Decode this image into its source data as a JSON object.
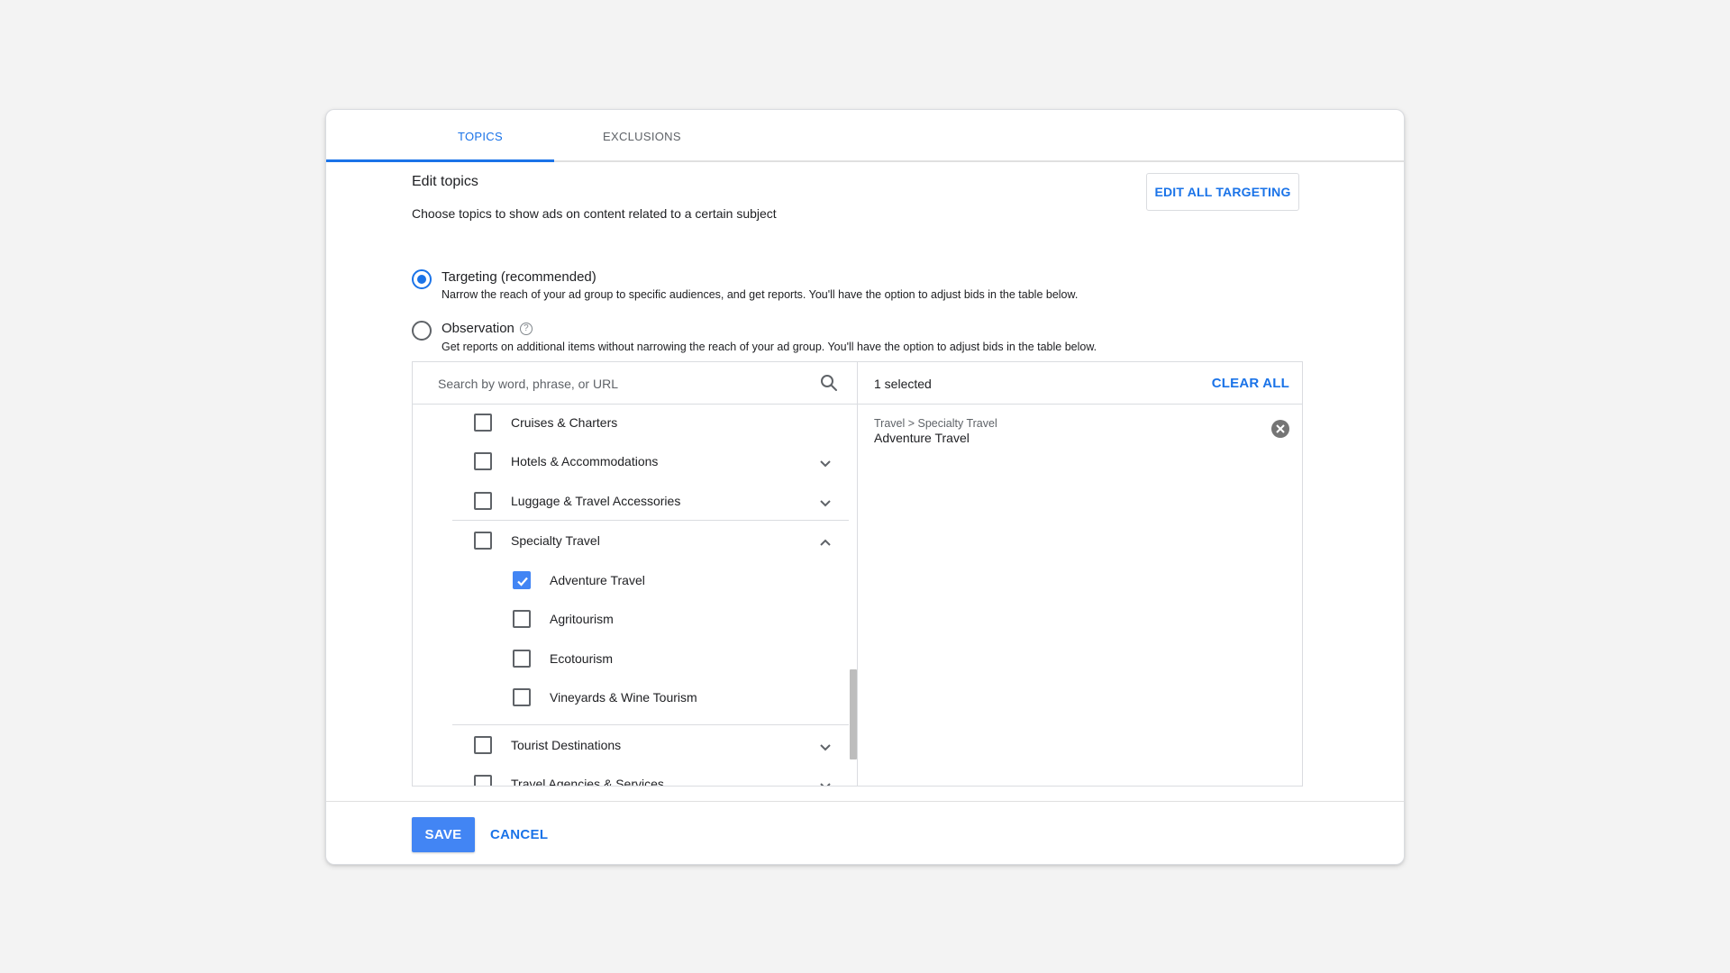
{
  "tabs": [
    {
      "label": "TOPICS",
      "active": true
    },
    {
      "label": "EXCLUSIONS",
      "active": false
    }
  ],
  "header": {
    "title": "Edit topics",
    "subtitle": "Choose topics to show ads on content related to a certain subject",
    "edit_all_label": "EDIT ALL TARGETING"
  },
  "targeting": {
    "options": [
      {
        "label": "Targeting (recommended)",
        "description": "Narrow the reach of your ad group to specific audiences, and get reports. You'll have the option to adjust bids in the table below.",
        "checked": true
      },
      {
        "label": "Observation",
        "description": "Get reports on additional items without narrowing the reach of your ad group. You'll have the option to adjust bids in the table below.",
        "checked": false
      }
    ],
    "help_glyph": "?"
  },
  "search": {
    "placeholder": "Search by word, phrase, or URL",
    "value": ""
  },
  "topics_list": [
    {
      "label": "Cruises & Charters",
      "checked": false,
      "expander": "none",
      "level": 1
    },
    {
      "label": "Hotels & Accommodations",
      "checked": false,
      "expander": "down",
      "level": 1
    },
    {
      "label": "Luggage & Travel Accessories",
      "checked": false,
      "expander": "down",
      "level": 1
    },
    {
      "label": "Specialty Travel",
      "checked": false,
      "expander": "up",
      "level": 1
    },
    {
      "label": "Adventure Travel",
      "checked": true,
      "expander": "none",
      "level": 2
    },
    {
      "label": "Agritourism",
      "checked": false,
      "expander": "none",
      "level": 2
    },
    {
      "label": "Ecotourism",
      "checked": false,
      "expander": "none",
      "level": 2
    },
    {
      "label": "Vineyards & Wine Tourism",
      "checked": false,
      "expander": "none",
      "level": 2
    },
    {
      "label": "Tourist Destinations",
      "checked": false,
      "expander": "down",
      "level": 1
    },
    {
      "label": "Travel Agencies & Services",
      "checked": false,
      "expander": "down",
      "level": 1
    }
  ],
  "selection": {
    "count_label": "1 selected",
    "clear_all_label": "CLEAR ALL",
    "items": [
      {
        "path": "Travel > Specialty Travel",
        "name": "Adventure Travel"
      }
    ]
  },
  "footer": {
    "save_label": "SAVE",
    "cancel_label": "CANCEL"
  },
  "colors": {
    "accent": "#1a73e8",
    "checkbox_checked": "#4285f4",
    "border": "#dadce0"
  }
}
